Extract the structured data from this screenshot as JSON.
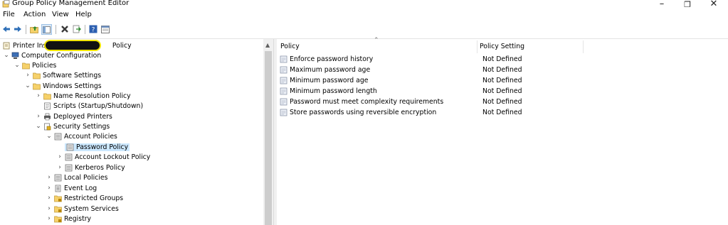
{
  "window": {
    "title": "Group Policy Management Editor",
    "controls": {
      "minimize": "–",
      "maximize": "❐",
      "close": "✕"
    }
  },
  "menu": [
    "File",
    "Action",
    "View",
    "Help"
  ],
  "toolbar_icons": [
    "back-icon",
    "forward-icon",
    "up-folder-icon",
    "show-hide-tree-icon",
    "delete-icon",
    "export-list-icon",
    "help-icon",
    "properties-icon"
  ],
  "tree": {
    "root": {
      "label_prefix": "Printer Install",
      "label_suffix": "Policy"
    },
    "items": [
      {
        "label": "Computer Configuration"
      },
      {
        "label": "Policies"
      },
      {
        "label": "Software Settings"
      },
      {
        "label": "Windows Settings"
      },
      {
        "label": "Name Resolution Policy"
      },
      {
        "label": "Scripts (Startup/Shutdown)"
      },
      {
        "label": "Deployed Printers"
      },
      {
        "label": "Security Settings"
      },
      {
        "label": "Account Policies"
      },
      {
        "label": "Password Policy"
      },
      {
        "label": "Account Lockout Policy"
      },
      {
        "label": "Kerberos Policy"
      },
      {
        "label": "Local Policies"
      },
      {
        "label": "Event Log"
      },
      {
        "label": "Restricted Groups"
      },
      {
        "label": "System Services"
      },
      {
        "label": "Registry"
      }
    ]
  },
  "list": {
    "columns": [
      "Policy",
      "Policy Setting"
    ],
    "rows": [
      {
        "policy": "Enforce password history",
        "setting": "Not Defined"
      },
      {
        "policy": "Maximum password age",
        "setting": "Not Defined"
      },
      {
        "policy": "Minimum password age",
        "setting": "Not Defined"
      },
      {
        "policy": "Minimum password length",
        "setting": "Not Defined"
      },
      {
        "policy": "Password must meet complexity requirements",
        "setting": "Not Defined"
      },
      {
        "policy": "Store passwords using reversible encryption",
        "setting": "Not Defined"
      }
    ]
  },
  "colors": {
    "selection": "#cce8ff",
    "folder": "#f6d16a",
    "redaction_highlight": "#f2e600"
  }
}
